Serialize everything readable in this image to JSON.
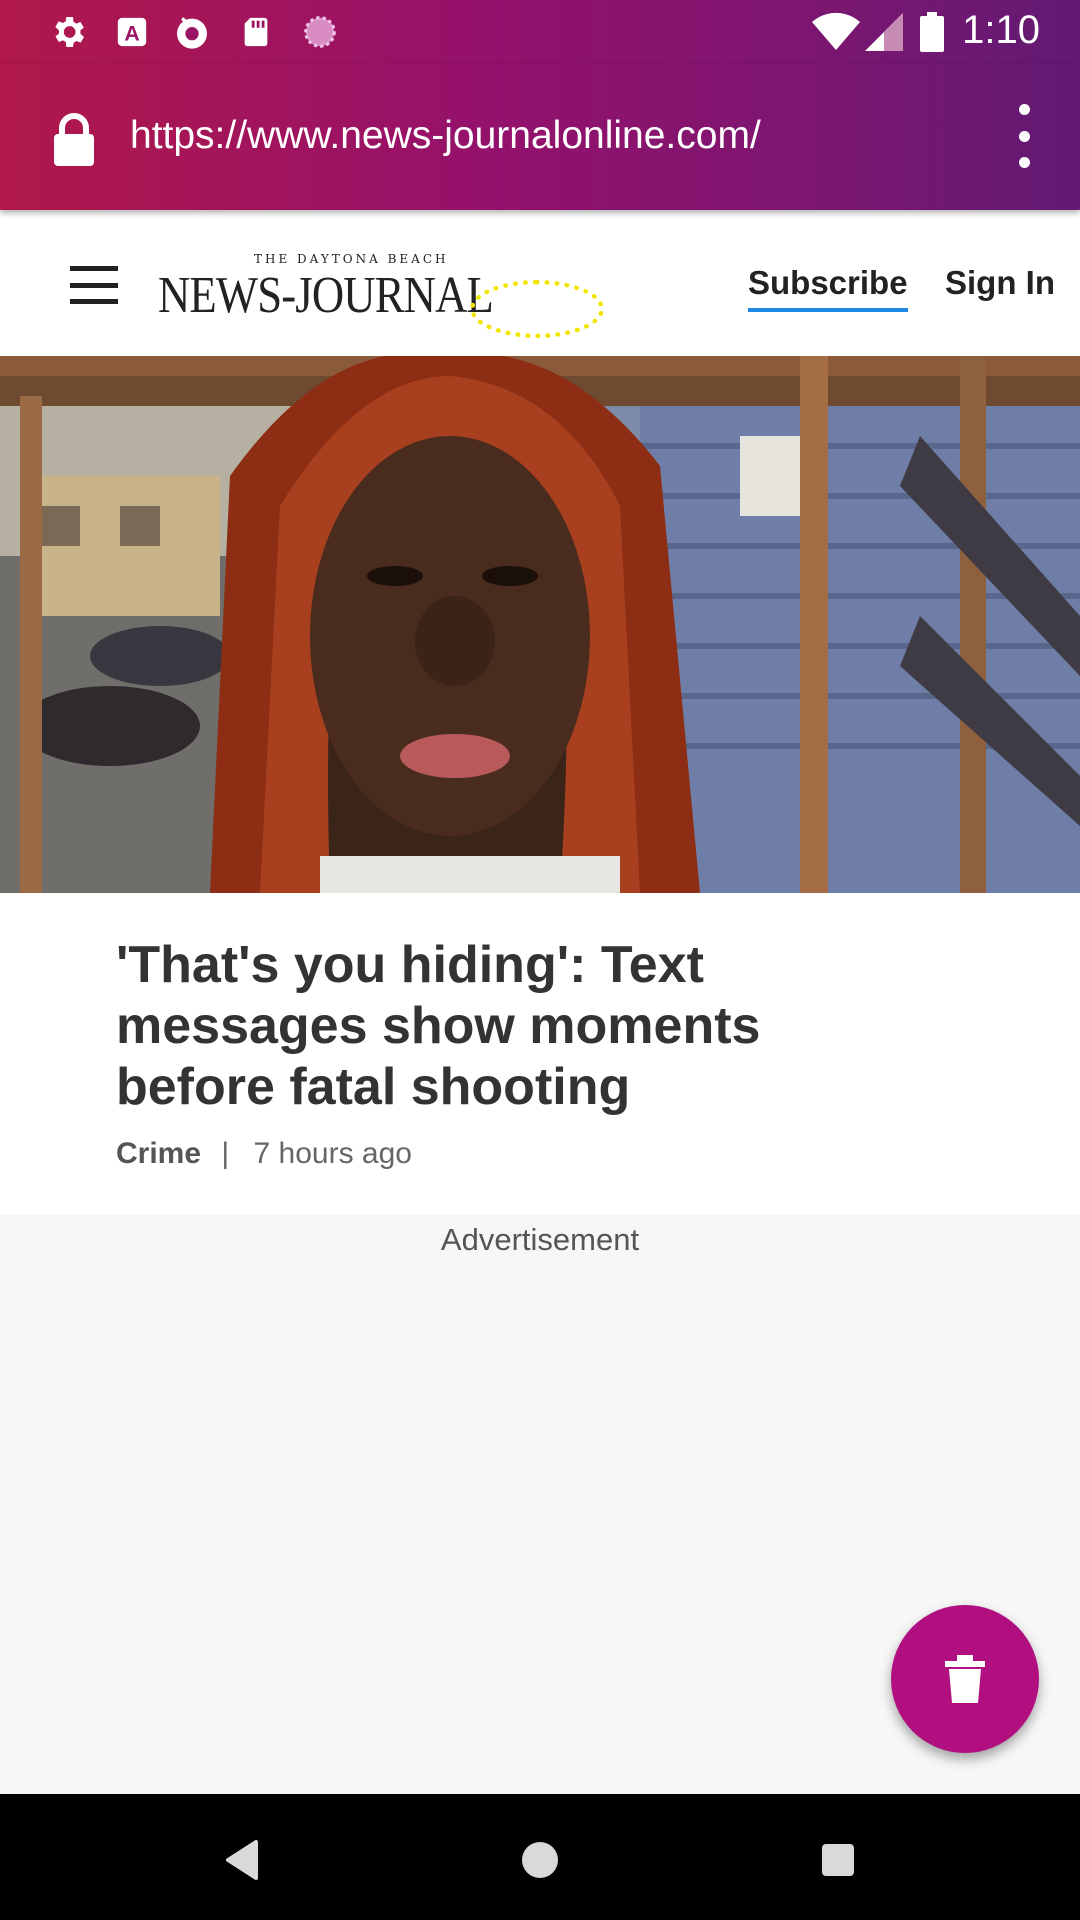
{
  "status_bar": {
    "time": "1:10",
    "notification_icons": [
      "settings-icon",
      "text-app-icon",
      "firefox-icon",
      "sd-card-icon",
      "loading-icon"
    ],
    "system_icons": [
      "wifi-icon",
      "signal-icon",
      "battery-icon"
    ]
  },
  "browser": {
    "url": "https://www.news-journalonline.com/",
    "icons": {
      "lock": "lock-icon",
      "menu": "more-vert-icon"
    },
    "theme_color": "#94116c"
  },
  "site": {
    "logo_small": "THE DAYTONA BEACH",
    "logo_main": "NEWS-JOURNAL",
    "subscribe": "Subscribe",
    "sign_in": "Sign In",
    "accent": "#1e88e5"
  },
  "article": {
    "headline": "'That's you hiding': Text messages show moments before fatal shooting",
    "category": "Crime",
    "separator": "|",
    "time_ago": "7 hours ago"
  },
  "ad": {
    "label": "Advertisement"
  },
  "fab": {
    "icon": "trash-icon",
    "color": "#b10f80"
  },
  "nav": {
    "icons": [
      "back-icon",
      "home-icon",
      "recents-icon"
    ]
  }
}
